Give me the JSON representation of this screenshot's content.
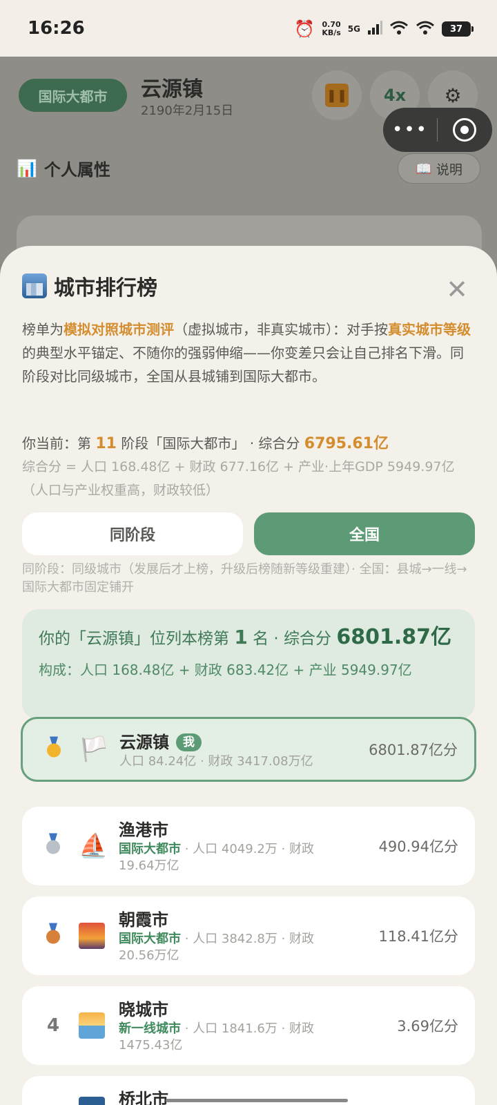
{
  "status_bar": {
    "time": "16:26",
    "net_speed_value": "0.70",
    "net_speed_unit": "KB/s",
    "network": "5G",
    "battery": "37",
    "icons": [
      "alarm-icon",
      "signal-icon",
      "wifi-icon",
      "battery-icon"
    ]
  },
  "background_app": {
    "stage_label": "国际大都市",
    "town_name": "云源镇",
    "date": "2190年2月15日",
    "speed_label": "4x",
    "section_title": "个人属性",
    "help_label": "说明"
  },
  "sheet": {
    "title": "城市排行榜",
    "intro_parts": {
      "p1": "榜单为",
      "h1": "模拟对照城市测评",
      "p2": "（虚拟城市，非真实城市）：对手按",
      "h2": "真实城市等级",
      "p3": "的典型水平锚定、不随你的强弱伸缩——你变差只会让自己排名下滑。同阶段对比同级城市，全国从县城铺到国际大都市。"
    },
    "current": {
      "prefix": "你当前：第",
      "stage_num": "11",
      "mid": "阶段「国际大都市」 · 综合分",
      "score": "6795.61亿"
    },
    "formula": "综合分 = 人口 168.48亿 + 财政 677.16亿 + 产业·上年GDP 5949.97亿（人口与产业权重高，财政较低）",
    "tabs": {
      "same_stage": "同阶段",
      "national": "全国",
      "active": "national"
    },
    "tab_note": "同阶段：同级城市（发展后才上榜，升级后榜随新等级重建）· 全国：县城→一线→国际大都市固定铺开",
    "summary": {
      "prefix": "你的「云源镇」位列本榜第",
      "rank": "1",
      "mid": "名 · 综合分",
      "score": "6801.87亿",
      "composition": "构成：人口 168.48亿 + 财政 683.42亿 + 产业 5949.97亿"
    },
    "rows": [
      {
        "rank": "",
        "medal": "gold",
        "emblem": "white-flag-icon",
        "name": "云源镇",
        "badge": "我",
        "tier": "",
        "sub": "人口 84.24亿 · 财政 3417.08万亿",
        "score": "6801.87亿分"
      },
      {
        "rank": "",
        "medal": "silver",
        "emblem": "sailboat-icon",
        "name": "渔港市",
        "badge": "",
        "tier": "国际大都市",
        "sub": " · 人口 4049.2万 · 财政 19.64万亿",
        "score": "490.94亿分"
      },
      {
        "rank": "",
        "medal": "bronze",
        "emblem": "sunset-icon",
        "name": "朝霞市",
        "badge": "",
        "tier": "国际大都市",
        "sub": " · 人口 3842.8万 · 财政 20.56万亿",
        "score": "118.41亿分"
      },
      {
        "rank": "4",
        "medal": "",
        "emblem": "sunrise-icon",
        "name": "晓城市",
        "badge": "",
        "tier": "新一线城市",
        "sub": " · 人口 1841.6万 · 财政 1475.43亿",
        "score": "3.69亿分"
      },
      {
        "rank": "",
        "medal": "",
        "emblem": "city-icon",
        "name": "桥北市",
        "badge": "",
        "tier": "",
        "sub": "",
        "score": ""
      }
    ]
  },
  "colors": {
    "accent_green": "#5d9b76",
    "highlight_orange": "#d48d2e",
    "sheet_bg": "#f4f1eb"
  }
}
